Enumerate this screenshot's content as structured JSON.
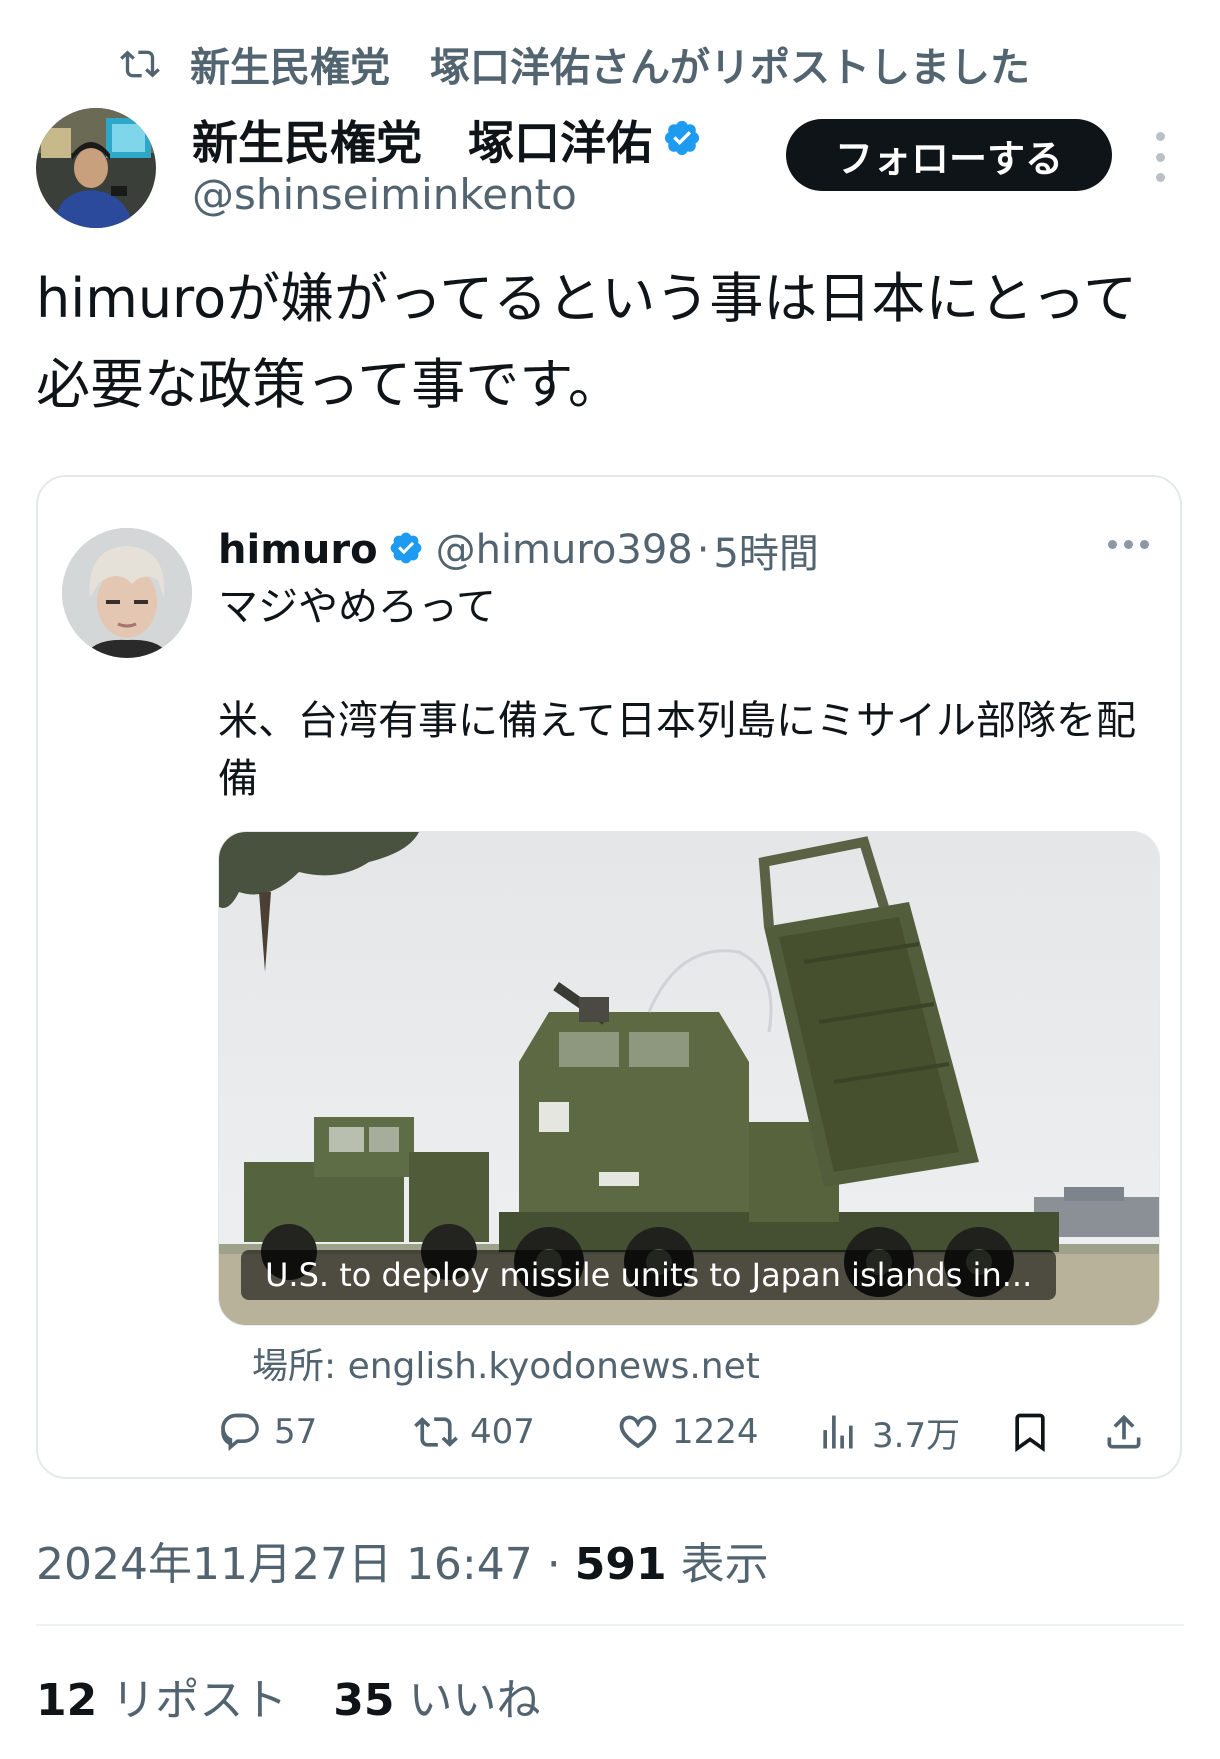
{
  "repost_header": {
    "text": "新生民権党　塚口洋佑さんがリポストしました"
  },
  "author": {
    "name": "新生民権党　塚口洋佑",
    "handle": "@shinseiminkento",
    "verified": true,
    "follow_label": "フォローする"
  },
  "tweet": {
    "text_line1": "himuroが嫌がってるという事は日本にとって",
    "text_line2": "必要な政策って事です。"
  },
  "quote": {
    "name": "himuro",
    "handle": "@himuro398",
    "separator": "·",
    "time": "5時間",
    "text1": "マジやめろって",
    "text2": "米、台湾有事に備えて日本列島にミサイル部隊を配備",
    "media_caption": "U.S. to deploy missile units to Japan islands in...",
    "source": "場所: english.kyodonews.net",
    "actions": {
      "replies": "57",
      "reposts": "407",
      "likes": "1224",
      "views": "3.7万"
    }
  },
  "meta": {
    "datetime": "2024年11月27日 16:47",
    "separator": "·",
    "views_count": "591",
    "views_label": "表示"
  },
  "stats": {
    "reposts_count": "12",
    "reposts_label": "リポスト",
    "likes_count": "35",
    "likes_label": "いいね"
  },
  "colors": {
    "verified_blue": "#1d9bf0",
    "secondary_text": "#536471",
    "primary_text": "#0f1419",
    "follow_button_bg": "#0f1419"
  }
}
